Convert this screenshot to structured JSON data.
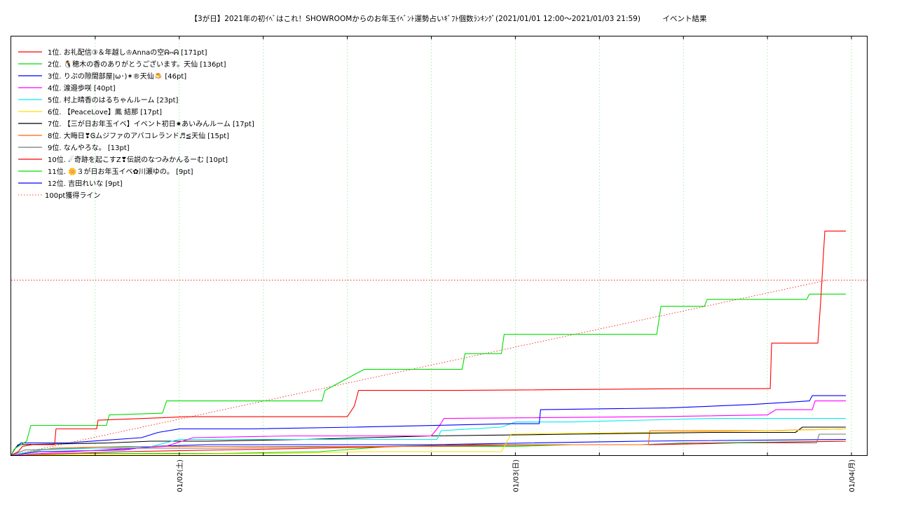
{
  "title": "【3が日】2021年の初ｲﾍﾞはこれ！SHOWROOMからのお年玉ｲﾍﾞﾝﾄ運勢占いｷﾞﾌﾄ個数ﾗﾝｷﾝｸﾞ(2021/01/01 12:00〜2021/01/03 21:59)　　　イベント結果",
  "chart_data": {
    "type": "line",
    "title": "【3が日】2021年の初ｲﾍﾞはこれ！SHOWROOMからのお年玉ｲﾍﾞﾝﾄ運勢占いｷﾞﾌﾄ個数ﾗﾝｷﾝｸﾞ(2021/01/01 12:00〜2021/01/03 21:59)　　　イベント結果",
    "x_unit": "hours",
    "x_ticks": [
      {
        "x": 12,
        "label": "01/02(土)"
      },
      {
        "x": 36,
        "label": "01/03(日)"
      },
      {
        "x": 60,
        "label": "01/04(月)"
      }
    ],
    "xlim": [
      0,
      61.1
    ],
    "ylim": [
      0,
      171
    ],
    "grid": true,
    "legend_position": "top-left",
    "series": [
      {
        "name": "1位. お礼配信③＆年越し♔Annaの空ᕱ⑅ᕱ [171pt]",
        "color": "#ff0000",
        "points": [
          [
            0,
            0
          ],
          [
            0.5,
            2
          ],
          [
            0.8,
            5
          ],
          [
            1.5,
            6
          ],
          [
            3.1,
            6
          ],
          [
            3.2,
            15
          ],
          [
            6.1,
            15
          ],
          [
            6.2,
            20
          ],
          [
            9.5,
            21
          ],
          [
            12.5,
            22
          ],
          [
            24,
            22
          ],
          [
            24.5,
            28
          ],
          [
            24.8,
            37
          ],
          [
            32,
            37
          ],
          [
            48.5,
            38
          ],
          [
            54.2,
            38
          ],
          [
            54.3,
            64
          ],
          [
            57.6,
            64
          ],
          [
            57.8,
            88
          ],
          [
            58.1,
            128
          ],
          [
            58.3,
            128
          ],
          [
            59.6,
            128
          ]
        ]
      },
      {
        "name": "2位. 🐧穂木の香のありがとうございます。天仙 [136pt]",
        "color": "#00dd00",
        "points": [
          [
            0,
            0
          ],
          [
            0.3,
            4
          ],
          [
            1.1,
            8
          ],
          [
            1.4,
            17
          ],
          [
            6.8,
            17
          ],
          [
            7,
            23
          ],
          [
            10.8,
            24
          ],
          [
            11.1,
            31
          ],
          [
            22.2,
            31
          ],
          [
            22.4,
            37
          ],
          [
            25.2,
            49
          ],
          [
            32.2,
            49
          ],
          [
            32.4,
            58
          ],
          [
            35,
            58
          ],
          [
            35.2,
            69
          ],
          [
            46.1,
            69
          ],
          [
            46.4,
            85
          ],
          [
            49.5,
            85
          ],
          [
            49.7,
            89
          ],
          [
            56.8,
            89
          ],
          [
            57,
            92
          ],
          [
            59.6,
            92
          ]
        ]
      },
      {
        "name": "3位. りぷの隙間部屋|ω･)✶®天仙🍮 [46pt]",
        "color": "#0000ff",
        "points": [
          [
            0,
            0
          ],
          [
            0.3,
            4
          ],
          [
            0.7,
            7
          ],
          [
            4,
            7
          ],
          [
            9.3,
            10
          ],
          [
            10.5,
            13
          ],
          [
            12,
            15
          ],
          [
            17,
            15
          ],
          [
            24.5,
            16
          ],
          [
            35.7,
            18
          ],
          [
            37.7,
            18
          ],
          [
            37.8,
            26
          ],
          [
            47,
            27
          ],
          [
            53,
            29
          ],
          [
            57,
            31
          ],
          [
            57.2,
            34
          ],
          [
            59.6,
            34
          ]
        ]
      },
      {
        "name": "4位. 渡邉歩咲 [40pt]",
        "color": "#ff00ff",
        "points": [
          [
            0,
            0
          ],
          [
            11,
            5
          ],
          [
            13,
            10
          ],
          [
            20,
            11
          ],
          [
            30,
            11
          ],
          [
            30.6,
            17
          ],
          [
            30.9,
            21
          ],
          [
            46,
            22
          ],
          [
            54,
            23
          ],
          [
            54.6,
            26
          ],
          [
            57.2,
            26
          ],
          [
            57.4,
            31
          ],
          [
            59.6,
            31
          ]
        ]
      },
      {
        "name": "5位. 村上晴香のはるちゃんルーム [23pt]",
        "color": "#00eeee",
        "points": [
          [
            0,
            0
          ],
          [
            2,
            3
          ],
          [
            10,
            5
          ],
          [
            12,
            9
          ],
          [
            16,
            9
          ],
          [
            30.4,
            9
          ],
          [
            30.7,
            14
          ],
          [
            35,
            16
          ],
          [
            36,
            19
          ],
          [
            40,
            19
          ],
          [
            50,
            21
          ],
          [
            59.6,
            21
          ]
        ]
      },
      {
        "name": "6位. 【PeaceLove】鳳 結那 [17pt]",
        "color": "#ffdd00",
        "points": [
          [
            0,
            0
          ],
          [
            20,
            1
          ],
          [
            25,
            2
          ],
          [
            35,
            2
          ],
          [
            35.7,
            12
          ],
          [
            45,
            13
          ],
          [
            55,
            14
          ],
          [
            59.6,
            15
          ]
        ]
      },
      {
        "name": "7位. 【三が日お年玉イベ】イベント初日✷あいみんルーム [17pt]",
        "color": "#000000",
        "points": [
          [
            0,
            0
          ],
          [
            0.2,
            3
          ],
          [
            0.5,
            6
          ],
          [
            7,
            7
          ],
          [
            10,
            8
          ],
          [
            14,
            8
          ],
          [
            21,
            9
          ],
          [
            30,
            11
          ],
          [
            40,
            12
          ],
          [
            50,
            13
          ],
          [
            56,
            13
          ],
          [
            56.5,
            16
          ],
          [
            59.6,
            16
          ]
        ]
      },
      {
        "name": "8位. 大晦日❣Ꮆムジファのアバコレランド♬≦天仙 [15pt]",
        "color": "#ff6600",
        "points": [
          [
            0,
            0
          ],
          [
            3,
            4
          ],
          [
            8,
            5
          ],
          [
            15,
            5
          ],
          [
            30,
            5
          ],
          [
            40,
            6
          ],
          [
            45.5,
            6
          ],
          [
            45.6,
            14
          ],
          [
            54,
            14
          ],
          [
            59.6,
            15
          ]
        ]
      },
      {
        "name": "9位. なんやろな。 [13pt]",
        "color": "#777777",
        "points": [
          [
            0,
            0
          ],
          [
            1,
            3
          ],
          [
            5,
            4
          ],
          [
            15,
            4
          ],
          [
            26,
            5
          ],
          [
            33,
            6
          ],
          [
            45,
            6
          ],
          [
            48,
            7
          ],
          [
            57.5,
            7
          ],
          [
            57.7,
            12
          ],
          [
            59.6,
            12
          ]
        ]
      },
      {
        "name": "10位. ☄奇跡を起こすZ❣伝説のなつみかんるーむ [10pt]",
        "color": "#ff0000",
        "points": [
          [
            0,
            0
          ],
          [
            8,
            2
          ],
          [
            15,
            3
          ],
          [
            22,
            4
          ],
          [
            28,
            5
          ],
          [
            36,
            6
          ],
          [
            46,
            6
          ],
          [
            52,
            7
          ],
          [
            59.6,
            8
          ]
        ]
      },
      {
        "name": "11位. 🌼３が日お年玉イベ✿川瀬ゆの。 [9pt]",
        "color": "#00dd00",
        "points": [
          [
            0,
            0
          ],
          [
            5,
            1
          ],
          [
            15,
            1
          ],
          [
            22,
            2
          ],
          [
            27,
            5
          ],
          [
            36,
            5
          ],
          [
            40,
            6
          ],
          [
            45,
            6
          ],
          [
            49,
            7
          ],
          [
            59.6,
            8
          ]
        ]
      },
      {
        "name": "12位. 吉田れいな [9pt]",
        "color": "#0000ff",
        "points": [
          [
            0,
            0
          ],
          [
            2,
            2
          ],
          [
            8,
            3
          ],
          [
            10,
            5
          ],
          [
            14,
            6
          ],
          [
            30,
            6
          ],
          [
            37,
            7
          ],
          [
            45,
            8
          ],
          [
            59.6,
            9
          ]
        ]
      }
    ],
    "reference_line": {
      "name": "100pt獲得ライン",
      "color": "#ff0000",
      "style": "dotted",
      "y": 100,
      "slope_start": [
        0,
        0
      ],
      "slope_end": [
        58.3,
        100
      ]
    }
  }
}
